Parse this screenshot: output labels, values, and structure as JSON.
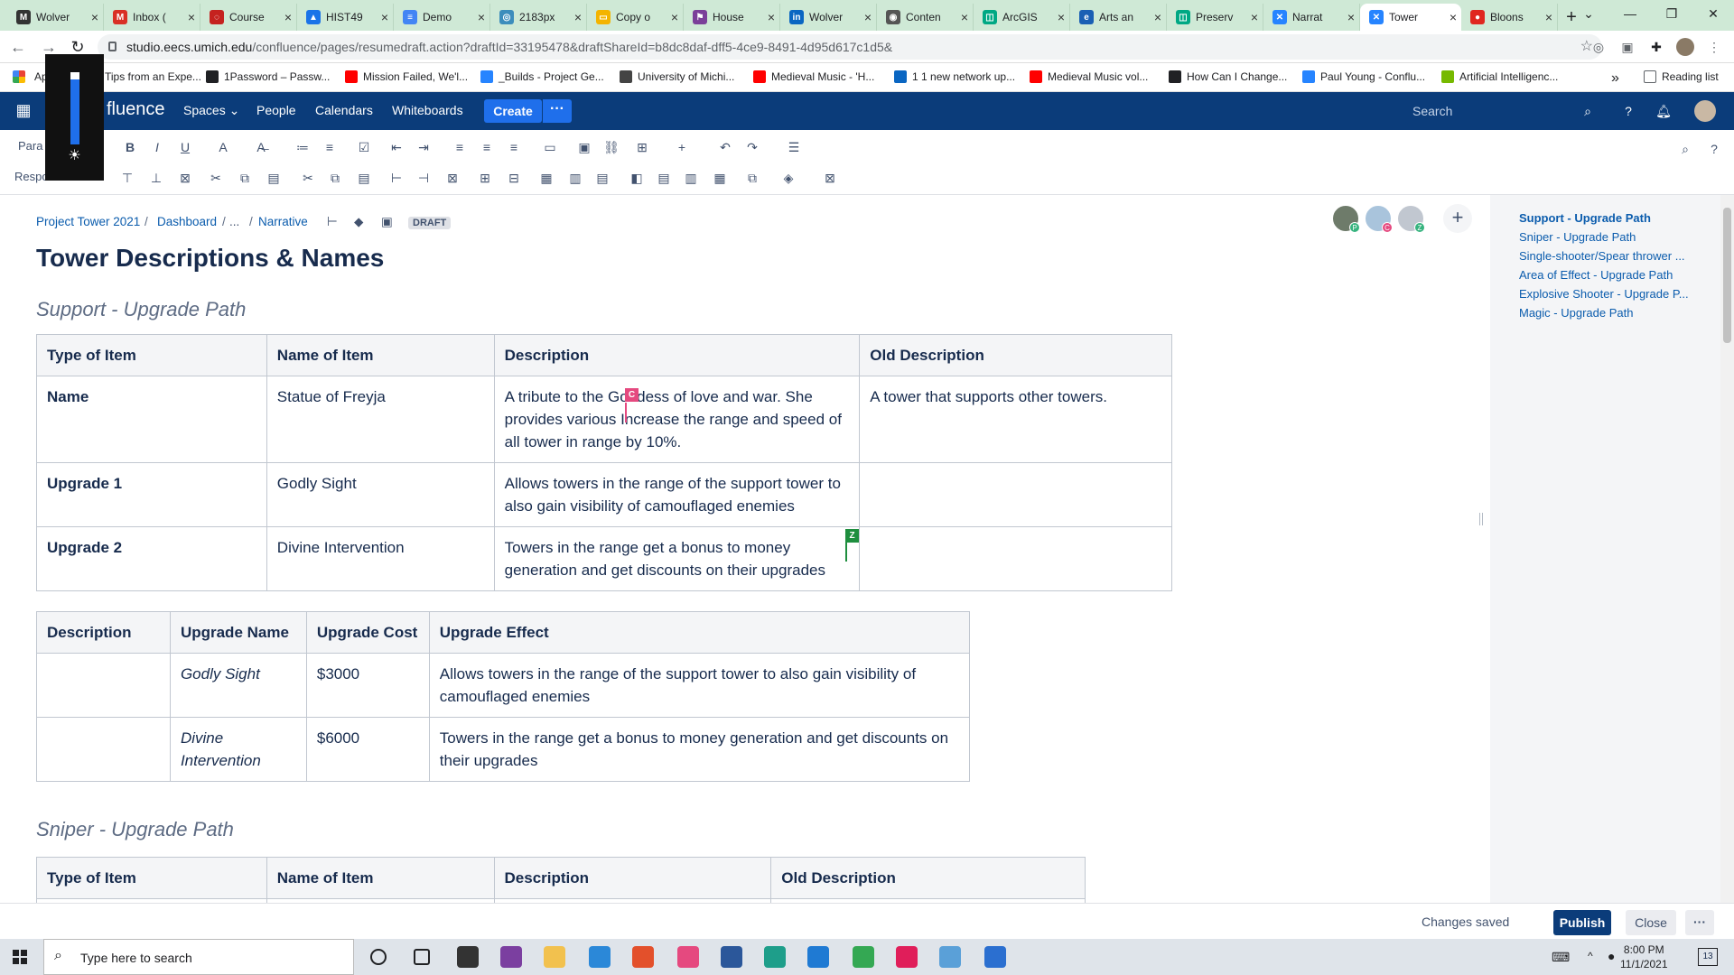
{
  "browser": {
    "tabs": [
      {
        "label": "Wolver",
        "color": "#333333",
        "glyph": "M"
      },
      {
        "label": "Inbox (",
        "color": "#d93025",
        "glyph": "M"
      },
      {
        "label": "Course",
        "color": "#c5221f",
        "glyph": "◌"
      },
      {
        "label": "HIST49",
        "color": "#1a73e8",
        "glyph": "▲"
      },
      {
        "label": "Demo",
        "color": "#4285f4",
        "glyph": "≡"
      },
      {
        "label": "2183px",
        "color": "#3c8dbc",
        "glyph": "◎"
      },
      {
        "label": "Copy o",
        "color": "#f4b400",
        "glyph": "▭"
      },
      {
        "label": "House",
        "color": "#7b3f99",
        "glyph": "⚑"
      },
      {
        "label": "Wolver",
        "color": "#0a66c2",
        "glyph": "in"
      },
      {
        "label": "Conten",
        "color": "#555555",
        "glyph": "◉"
      },
      {
        "label": "ArcGIS",
        "color": "#00a884",
        "glyph": "◫"
      },
      {
        "label": "Arts an",
        "color": "#1a5fb4",
        "glyph": "e"
      },
      {
        "label": "Preserv",
        "color": "#00a884",
        "glyph": "◫"
      },
      {
        "label": "Narrat",
        "color": "#2684ff",
        "glyph": "✕"
      },
      {
        "label": "Tower",
        "color": "#2684ff",
        "glyph": "✕",
        "active": true
      },
      {
        "label": "Bloons",
        "color": "#e0261f",
        "glyph": "●"
      }
    ],
    "url_host": "studio.eecs.umich.edu",
    "url_path": "/confluence/pages/resumedraft.action?draftId=33195478&draftShareId=b8dc8daf-dff5-4ce9-8491-4d95d617c1d5&",
    "bookmarks": [
      "Ap",
      "Tips from an Expe...",
      "1Password – Passw...",
      "Mission Failed, We'l...",
      "_Builds - Project Ge...",
      "University of Michi...",
      "Medieval Music - 'H...",
      "1 1 new network up...",
      "Medieval Music vol...",
      "How Can I Change...",
      "Paul Young - Conflu...",
      "Artificial Intelligenc..."
    ],
    "bookmark_overflow": "»",
    "reading_list": "Reading list"
  },
  "confluence": {
    "logo_text": "Confluence",
    "logo_visible": "fluence",
    "nav": {
      "spaces": "Spaces",
      "people": "People",
      "calendars": "Calendars",
      "whiteboards": "Whiteboards"
    },
    "create": "Create",
    "more": "···",
    "search_placeholder": "Search"
  },
  "toolbar": {
    "paragraph": "Paragraph",
    "paragraph_visible": "Para",
    "responsive": "Responsive",
    "responsive_visible": "Respo"
  },
  "page": {
    "breadcrumb": [
      "Project Tower 2021",
      "Dashboard",
      "...",
      "Narrative"
    ],
    "status": "DRAFT",
    "title": "Tower Descriptions & Names",
    "sections": [
      {
        "heading": "Support - Upgrade Path"
      },
      {
        "heading": "Sniper - Upgrade Path"
      }
    ],
    "table1": {
      "headers": [
        "Type of Item",
        "Name of Item",
        "Description",
        "Old Description"
      ],
      "rows": [
        [
          "Name",
          "Statue of Freyja",
          "A tribute to the Goddess of love and war. She provides various Increase the range and speed of all tower in range by 10%.",
          "A tower that supports other towers."
        ],
        [
          "Upgrade 1",
          "Godly Sight",
          "Allows towers in the range of the support tower to also gain visibility of camouflaged enemies",
          ""
        ],
        [
          "Upgrade 2",
          "Divine Intervention",
          "Towers in the range get a bonus to money generation and get discounts on their upgrades",
          ""
        ]
      ]
    },
    "table2": {
      "headers": [
        "Description",
        "Upgrade Name",
        "Upgrade Cost",
        "Upgrade Effect"
      ],
      "rows": [
        [
          "",
          "Godly Sight",
          "$3000",
          "Allows towers in the range of the support tower to also gain visibility of camouflaged enemies"
        ],
        [
          "",
          "Divine Intervention",
          "$6000",
          "Towers in the range get a bonus to money generation and get discounts on their upgrades"
        ]
      ]
    },
    "table3": {
      "headers": [
        "Type of Item",
        "Name of Item",
        "Description",
        "Old Description"
      ]
    },
    "collab_markers": {
      "c": "C",
      "z": "Z"
    },
    "avatar_badges": [
      "P",
      "C",
      "Z"
    ],
    "add_collaborator": "+"
  },
  "toc": {
    "items": [
      "Support - Upgrade Path",
      "Sniper - Upgrade Path",
      "Single-shooter/Spear thrower ...",
      "Area of Effect - Upgrade Path",
      "Explosive Shooter - Upgrade P...",
      "Magic - Upgrade Path"
    ]
  },
  "footer": {
    "status": "Changes saved",
    "publish": "Publish",
    "close": "Close",
    "more": "···"
  },
  "taskbar": {
    "search_placeholder": "Type here to search",
    "time": "8:00 PM",
    "date": "11/1/2021",
    "notifications": "13"
  },
  "colors": {
    "header": "#0b3c7a",
    "accent": "#1f6feb",
    "link": "#0b5cad",
    "tab_strip": "#cfe9d6"
  }
}
